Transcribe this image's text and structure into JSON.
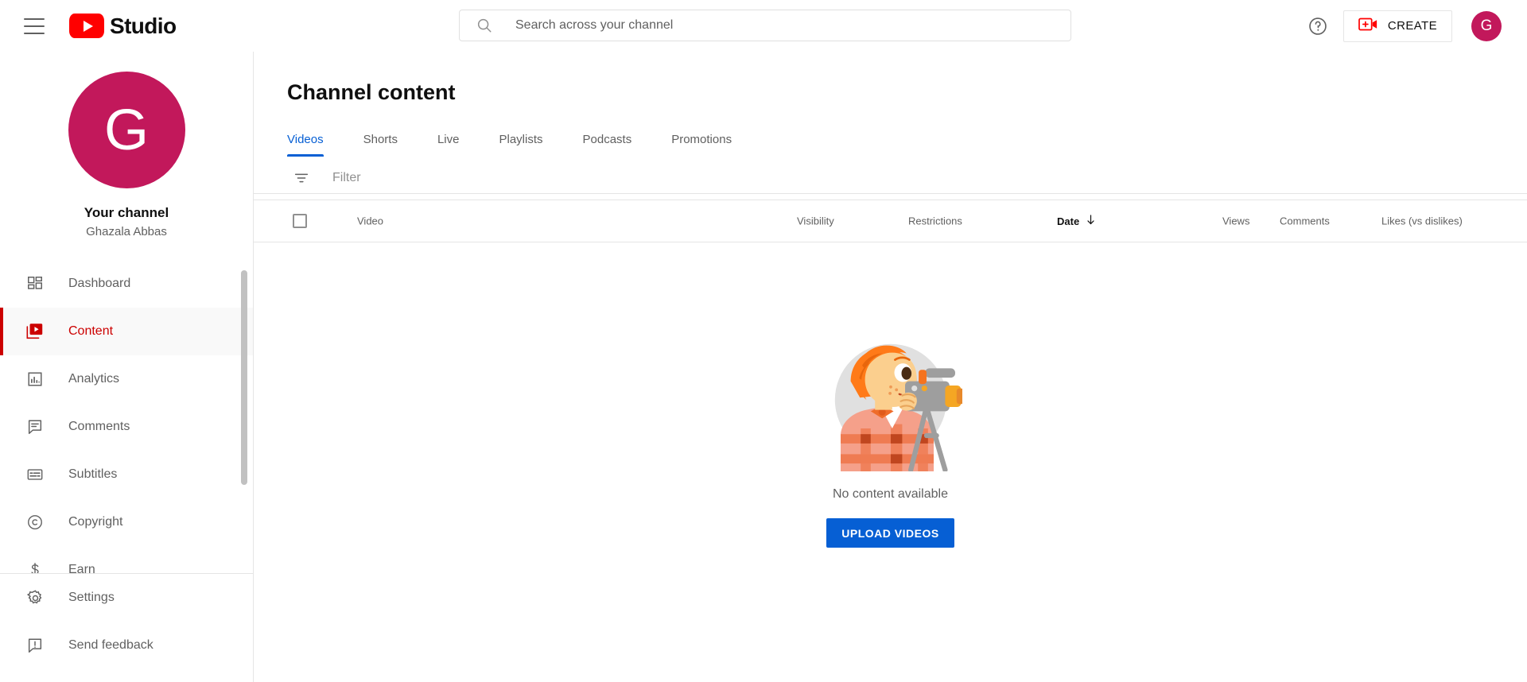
{
  "topbar": {
    "menu_icon": "hamburger-menu-icon",
    "logo_text": "Studio",
    "search": {
      "placeholder": "Search across your channel",
      "value": "",
      "icon": "search-icon"
    },
    "help_icon": "help-circle-icon",
    "create_label": "CREATE",
    "create_icon": "video-plus-icon",
    "account_initial": "G"
  },
  "sidebar": {
    "avatar_initial": "G",
    "channel_title": "Your channel",
    "channel_name": "Ghazala Abbas",
    "items": [
      {
        "label": "Dashboard",
        "icon": "dashboard-grid-icon",
        "active": false
      },
      {
        "label": "Content",
        "icon": "content-video-icon",
        "active": true
      },
      {
        "label": "Analytics",
        "icon": "analytics-bar-chart-icon",
        "active": false
      },
      {
        "label": "Comments",
        "icon": "comment-bubble-icon",
        "active": false
      },
      {
        "label": "Subtitles",
        "icon": "subtitles-icon",
        "active": false
      },
      {
        "label": "Copyright",
        "icon": "copyright-circle-icon",
        "active": false
      },
      {
        "label": "Earn",
        "icon": "earn-dollar-icon",
        "active": false
      }
    ],
    "footer_items": [
      {
        "label": "Settings",
        "icon": "gear-icon"
      },
      {
        "label": "Send feedback",
        "icon": "feedback-exclamation-icon"
      }
    ]
  },
  "main": {
    "page_title": "Channel content",
    "tabs": [
      {
        "label": "Videos",
        "active": true
      },
      {
        "label": "Shorts",
        "active": false
      },
      {
        "label": "Live",
        "active": false
      },
      {
        "label": "Playlists",
        "active": false
      },
      {
        "label": "Podcasts",
        "active": false
      },
      {
        "label": "Promotions",
        "active": false
      }
    ],
    "filter": {
      "icon": "filter-icon",
      "placeholder": "Filter",
      "value": ""
    },
    "table": {
      "select_all_checked": false,
      "columns": [
        {
          "key": "video",
          "label": "Video"
        },
        {
          "key": "visibility",
          "label": "Visibility"
        },
        {
          "key": "restrictions",
          "label": "Restrictions"
        },
        {
          "key": "date",
          "label": "Date",
          "sorted": true,
          "sort_direction": "descending",
          "sort_icon": "arrow-down-icon"
        },
        {
          "key": "views",
          "label": "Views"
        },
        {
          "key": "comments",
          "label": "Comments"
        },
        {
          "key": "likes",
          "label": "Likes (vs dislikes)"
        }
      ],
      "rows": []
    },
    "empty_state": {
      "illustration": "videographer-with-camera-illustration",
      "message": "No content available",
      "upload_button_label": "UPLOAD VIDEOS"
    }
  },
  "colors": {
    "brand_red": "#ff0000",
    "active_red": "#cc0000",
    "accent_blue": "#065fd4",
    "avatar_pink": "#c2185b",
    "text_primary": "#0f0f0f",
    "text_secondary": "#606060",
    "border": "#e5e5e5"
  }
}
